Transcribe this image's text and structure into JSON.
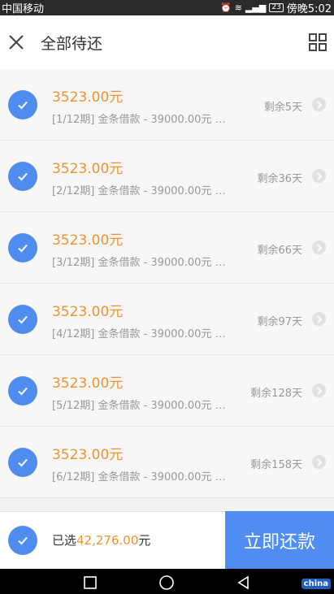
{
  "status_bar": {
    "carrier": "中国移动",
    "battery": "23",
    "time": "傍晚5:02"
  },
  "header": {
    "title": "全部待还"
  },
  "installments": [
    {
      "amount": "3523.00元",
      "desc": "[1/12期] 金条借款 - 39000.00元 …",
      "remaining": "剩余5天"
    },
    {
      "amount": "3523.00元",
      "desc": "[2/12期] 金条借款 - 39000.00元 …",
      "remaining": "剩余36天"
    },
    {
      "amount": "3523.00元",
      "desc": "[3/12期] 金条借款 - 39000.00元 …",
      "remaining": "剩余66天"
    },
    {
      "amount": "3523.00元",
      "desc": "[4/12期] 金条借款 - 39000.00元 …",
      "remaining": "剩余97天"
    },
    {
      "amount": "3523.00元",
      "desc": "[5/12期] 金条借款 - 39000.00元 …",
      "remaining": "剩余128天"
    },
    {
      "amount": "3523.00元",
      "desc": "[6/12期] 金条借款 - 39000.00元 …",
      "remaining": "剩余158天"
    }
  ],
  "footer": {
    "selected_label": "已选",
    "selected_amount": "42,276.00",
    "currency": "元",
    "pay_button": "立即还款"
  },
  "watermark": "china",
  "colors": {
    "accent_blue": "#4f8ef0",
    "amount_orange": "#f5902a"
  }
}
